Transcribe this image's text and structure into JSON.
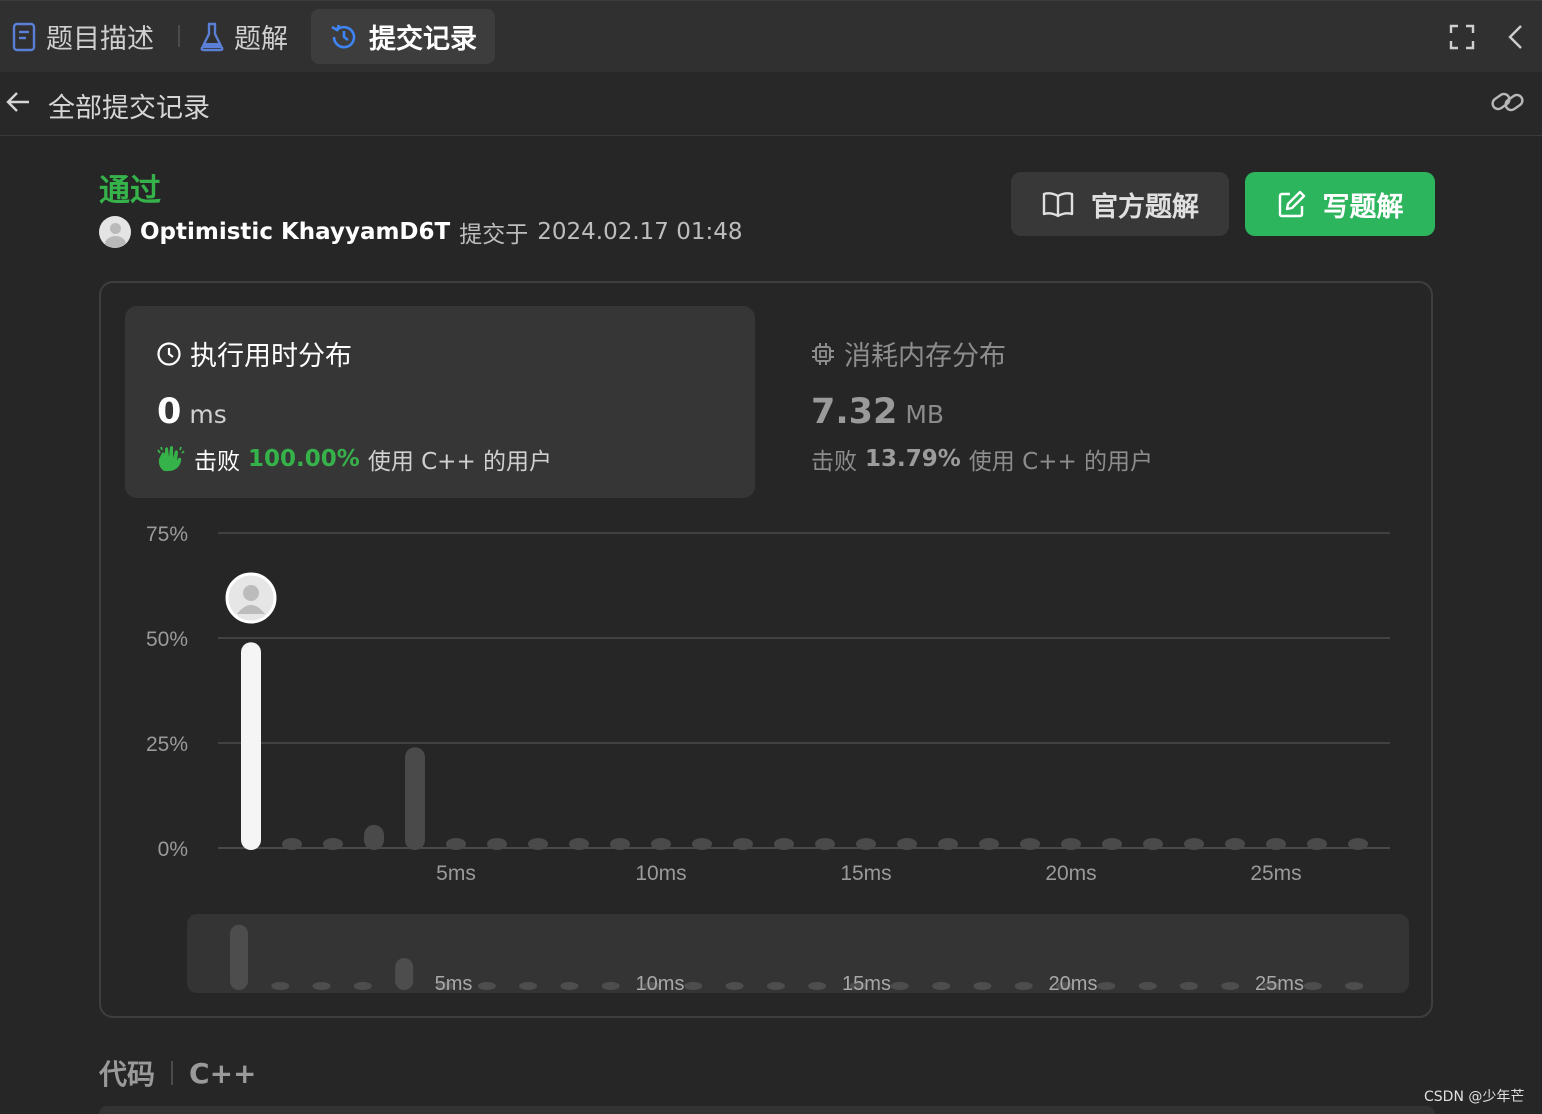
{
  "tabs": {
    "description": "题目描述",
    "solutions": "题解",
    "submissions": "提交记录"
  },
  "subheader": {
    "title": "全部提交记录"
  },
  "submission": {
    "status": "通过",
    "user": "Optimistic KhayyamD6T",
    "submitted_prefix": "提交于",
    "time": "2024.02.17 01:48"
  },
  "buttons": {
    "official": "官方题解",
    "write": "写题解"
  },
  "runtime": {
    "title": "执行用时分布",
    "value": "0",
    "unit": "ms",
    "beat_prefix": "击败",
    "beat_pct": "100.00%",
    "beat_suffix": "使用 C++ 的用户"
  },
  "memory": {
    "title": "消耗内存分布",
    "value": "7.32",
    "unit": "MB",
    "beat_prefix": "击败",
    "beat_pct": "13.79%",
    "beat_suffix": "使用 C++ 的用户"
  },
  "code_section": {
    "label": "代码",
    "language": "C++"
  },
  "watermark": "CSDN @少年芒",
  "colors": {
    "accent_green": "#2db55d",
    "status_green": "#36b24a",
    "active_tab_icon": "#3f84f5"
  },
  "icons": {
    "tab_description": "document-icon",
    "tab_solutions": "flask-icon",
    "tab_submissions": "history-icon",
    "fullscreen": "fullscreen-icon",
    "collapse": "chevron-left-icon",
    "back": "arrow-left-icon",
    "link": "link-icon",
    "official": "book-icon",
    "write": "edit-icon",
    "runtime": "clock-icon",
    "memory": "chip-icon",
    "beat": "clap-icon"
  },
  "chart_data": {
    "type": "bar",
    "title": "",
    "xlabel": "",
    "ylabel": "",
    "x_tick_labels": [
      "5ms",
      "10ms",
      "15ms",
      "20ms",
      "25ms"
    ],
    "y_tick_labels": [
      "75%",
      "50%",
      "25%",
      "0%"
    ],
    "ylim": [
      0,
      75
    ],
    "x": [
      0,
      1,
      2,
      3,
      4,
      5,
      6,
      7,
      8,
      9,
      10,
      11,
      12,
      13,
      14,
      15,
      16,
      17,
      18,
      19,
      20,
      21,
      22,
      23,
      24,
      25,
      26,
      27
    ],
    "values": [
      49,
      1,
      1,
      5.5,
      24,
      1,
      1,
      1,
      1,
      1,
      1,
      1,
      1,
      1,
      1,
      1,
      1,
      1,
      1,
      1,
      1,
      1,
      1,
      1,
      1,
      1,
      1,
      1
    ],
    "highlight_index": 0,
    "grid": true,
    "navigator": true
  }
}
